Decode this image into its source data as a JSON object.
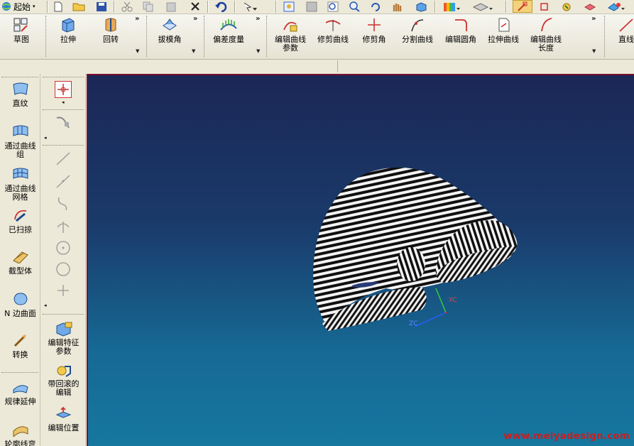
{
  "top_toolbar": {
    "start_label": "起始",
    "start_arrow": "▾"
  },
  "feature_bar": {
    "chevron": "»",
    "buttons": [
      {
        "label": "草图",
        "icon": "sketch-icon"
      },
      {
        "label": "拉伸",
        "icon": "extrude-icon"
      },
      {
        "label": "回转",
        "icon": "revolve-icon"
      },
      {
        "label": "拔模角",
        "icon": "draft-icon"
      },
      {
        "label": "偏差度量",
        "icon": "deviation-icon"
      },
      {
        "label": "编辑曲线\n参数",
        "icon": "edit-curve-params-icon"
      },
      {
        "label": "修剪曲线",
        "icon": "trim-curve-icon"
      },
      {
        "label": "修剪角",
        "icon": "trim-corner-icon"
      },
      {
        "label": "分割曲线",
        "icon": "divide-curve-icon"
      },
      {
        "label": "编辑圆角",
        "icon": "edit-fillet-icon"
      },
      {
        "label": "拉伸曲线",
        "icon": "stretch-curve-icon"
      },
      {
        "label": "编辑曲线\n长度",
        "icon": "edit-curve-length-icon"
      },
      {
        "label": "直线",
        "icon": "line-icon"
      }
    ]
  },
  "left_palette": {
    "items": [
      {
        "label": "直纹",
        "icon": "ruled-surface-icon"
      },
      {
        "label": "通过曲线\n组",
        "icon": "through-curves-icon"
      },
      {
        "label": "通过曲线\n网格",
        "icon": "through-curve-mesh-icon"
      },
      {
        "label": "已扫掠",
        "icon": "swept-icon"
      },
      {
        "label": "截型体",
        "icon": "section-body-icon"
      },
      {
        "label": "N 边曲面",
        "icon": "n-sided-surface-icon"
      },
      {
        "label": "转换",
        "icon": "transform-icon"
      },
      {
        "label": "规律延伸",
        "icon": "law-extension-icon"
      },
      {
        "label": "轮廓线弯",
        "icon": "profile-bend-icon"
      }
    ]
  },
  "tool_palette": {
    "items": [
      {
        "label": "编辑特征\n参数",
        "icon": "edit-feature-params-icon"
      },
      {
        "label": "带回滚的\n编辑",
        "icon": "edit-with-rollback-icon"
      },
      {
        "label": "编辑位置",
        "icon": "edit-position-icon"
      }
    ]
  },
  "viewport": {
    "axis_labels": {
      "xc": "XC",
      "zc": "ZC"
    },
    "watermark": "www.meiyadesign.com"
  }
}
